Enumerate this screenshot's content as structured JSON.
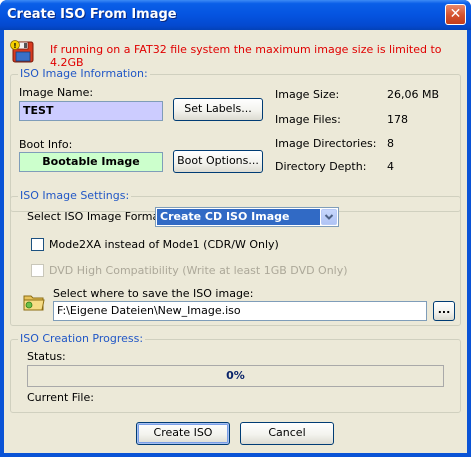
{
  "window": {
    "title": "Create ISO From Image",
    "close_glyph": "✕"
  },
  "warning": {
    "icon": "floppy-warning-icon",
    "text": "If running on a FAT32 file system the maximum image size is limited to 4.2GB"
  },
  "iso_info": {
    "legend": "ISO Image Information:",
    "image_name_label": "Image Name:",
    "image_name_value": "TEST",
    "set_labels_button": "Set Labels...",
    "boot_info_label": "Boot Info:",
    "boot_info_value": "Bootable Image",
    "boot_options_button": "Boot Options...",
    "stats": [
      {
        "label": "Image Size:",
        "value": "26,06 MB"
      },
      {
        "label": "Image Files:",
        "value": "178"
      },
      {
        "label": "Image Directories:",
        "value": "8"
      },
      {
        "label": "Directory Depth:",
        "value": "4"
      }
    ]
  },
  "iso_settings": {
    "legend": "ISO Image Settings:",
    "format_label": "Select ISO Image Format:",
    "format_value": "Create CD ISO Image",
    "mode2xa_label": "Mode2XA instead of Mode1 (CDR/W Only)",
    "mode2xa_checked": false,
    "dvd_label": "DVD High Compatibility (Write at least 1GB DVD Only)",
    "dvd_checked": false,
    "dvd_enabled": false,
    "save_label": "Select where to save the ISO image:",
    "save_path": "F:\\Eigene Dateien\\New_Image.iso",
    "browse_button": "...",
    "folder_icon": "folder-icon"
  },
  "progress": {
    "legend": "ISO Creation Progress:",
    "status_label": "Status:",
    "percent_text": "0%",
    "percent_value": 0,
    "current_file_label": "Current File:"
  },
  "footer": {
    "create_button": "Create ISO",
    "cancel_button": "Cancel"
  },
  "colors": {
    "titlebar": "#0554e0",
    "warning_text": "#e00000",
    "legend_text": "#2157c6",
    "image_name_bg": "#ccccff",
    "boot_info_bg": "#ccffcc",
    "select_highlight": "#316ac5"
  }
}
